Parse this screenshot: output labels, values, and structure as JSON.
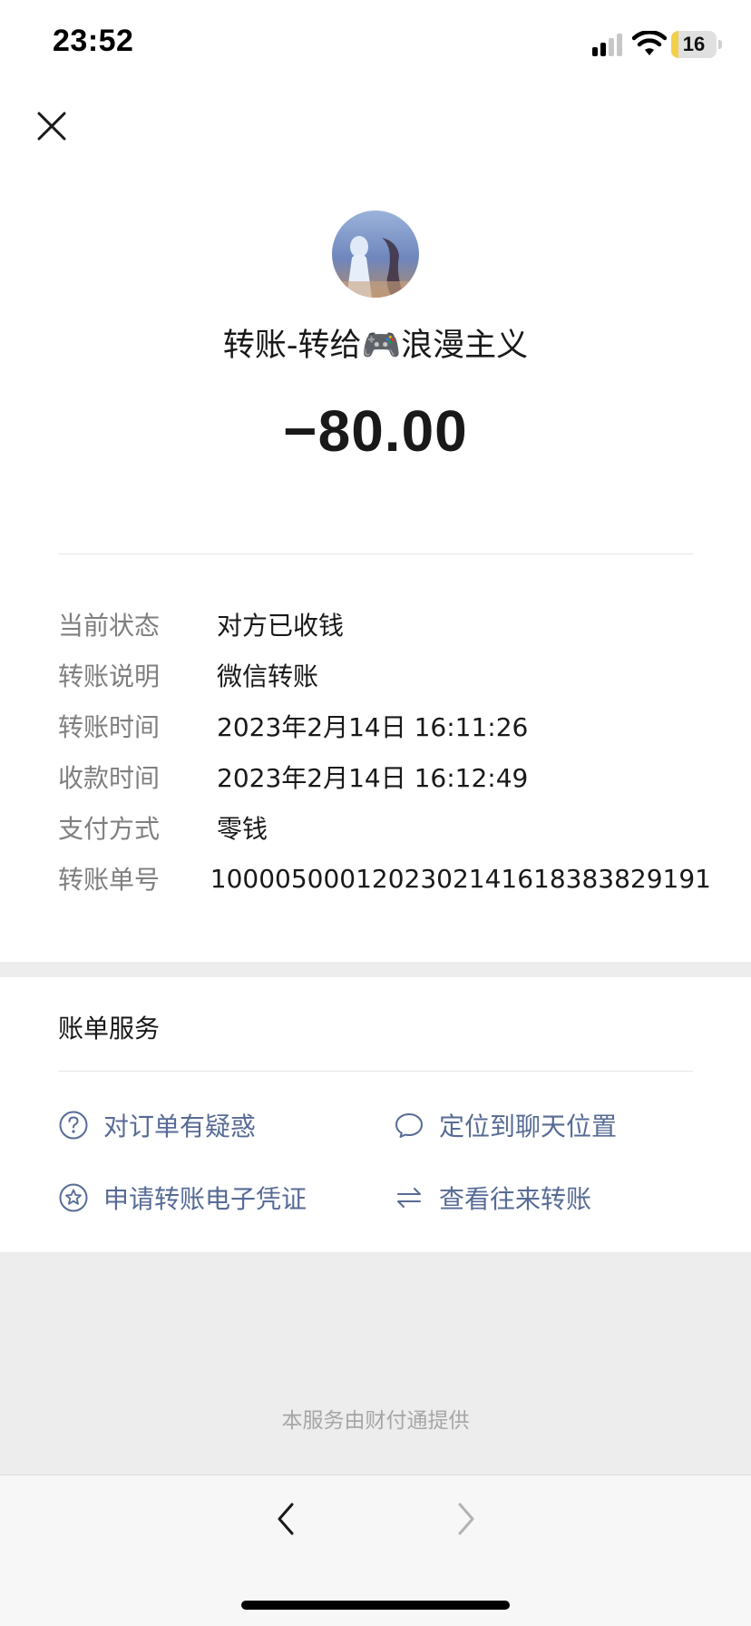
{
  "status_bar": {
    "time": "23:52",
    "battery_level": "16",
    "battery_fraction": 0.16
  },
  "header": {
    "close_icon": "close-icon",
    "title": "转账-转给🎮浪漫主义",
    "amount": "−80.00"
  },
  "details": [
    {
      "label": "当前状态",
      "value": "对方已收钱"
    },
    {
      "label": "转账说明",
      "value": "微信转账"
    },
    {
      "label": "转账时间",
      "value": "2023年2月14日 16:11:26"
    },
    {
      "label": "收款时间",
      "value": "2023年2月14日 16:12:49"
    },
    {
      "label": "支付方式",
      "value": "零钱"
    },
    {
      "label": "转账单号",
      "value": "1000050001202302141618383829191"
    }
  ],
  "services": {
    "title": "账单服务",
    "items": [
      {
        "label": "对订单有疑惑",
        "icon": "question-circle-icon"
      },
      {
        "label": "定位到聊天位置",
        "icon": "chat-bubble-icon"
      },
      {
        "label": "申请转账电子凭证",
        "icon": "star-circle-icon"
      },
      {
        "label": "查看往来转账",
        "icon": "swap-arrows-icon"
      }
    ]
  },
  "footer": {
    "note": "本服务由财付通提供"
  },
  "colors": {
    "link": "#576b95",
    "label_gray": "#7f7f7f",
    "section_bg": "#ededed"
  }
}
